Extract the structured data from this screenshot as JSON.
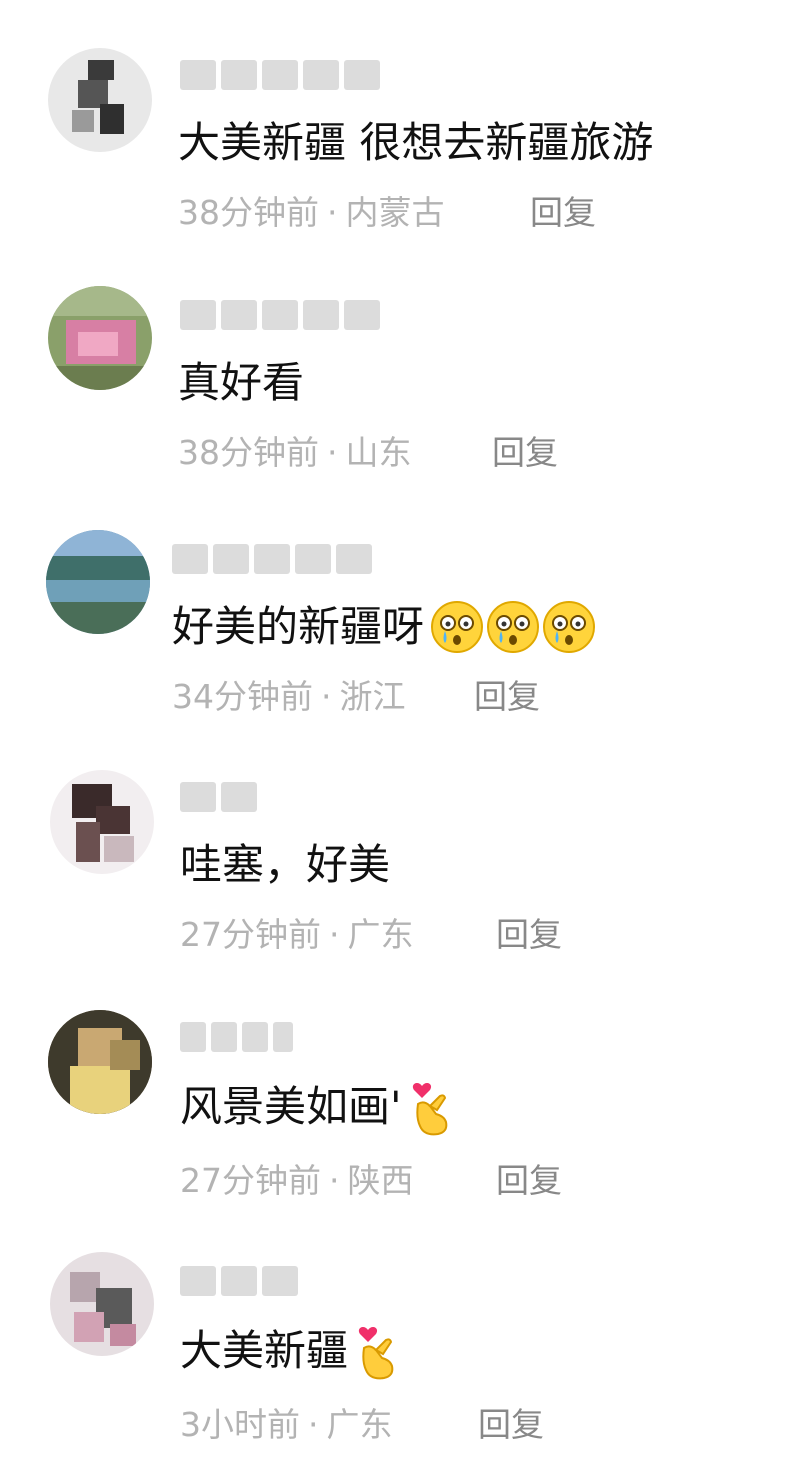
{
  "comments": [
    {
      "username": "",
      "text": "大美新疆 很想去新疆旅游",
      "time": "38分钟前",
      "location": "内蒙古",
      "emojis": []
    },
    {
      "username": "",
      "text": "真好看",
      "time": "38分钟前",
      "location": "山东",
      "emojis": []
    },
    {
      "username": "",
      "text": "好美的新疆呀",
      "time": "34分钟前",
      "location": "浙江",
      "emojis": [
        "crying-face",
        "crying-face",
        "crying-face"
      ]
    },
    {
      "username": "",
      "text": "哇塞，好美",
      "time": "27分钟前",
      "location": "广东",
      "emojis": []
    },
    {
      "username": "",
      "text": "风景美如画'",
      "time": "27分钟前",
      "location": "陕西",
      "emojis": [
        "finger-heart"
      ]
    },
    {
      "username": "",
      "text": "大美新疆",
      "time": "3小时前",
      "location": "广东",
      "emojis": [
        "finger-heart"
      ]
    }
  ],
  "reply_label": "回复",
  "meta_separator": "·",
  "colors": {
    "text": "#111111",
    "meta": "#b3b3b3",
    "reply": "#888888",
    "background": "#ffffff"
  }
}
